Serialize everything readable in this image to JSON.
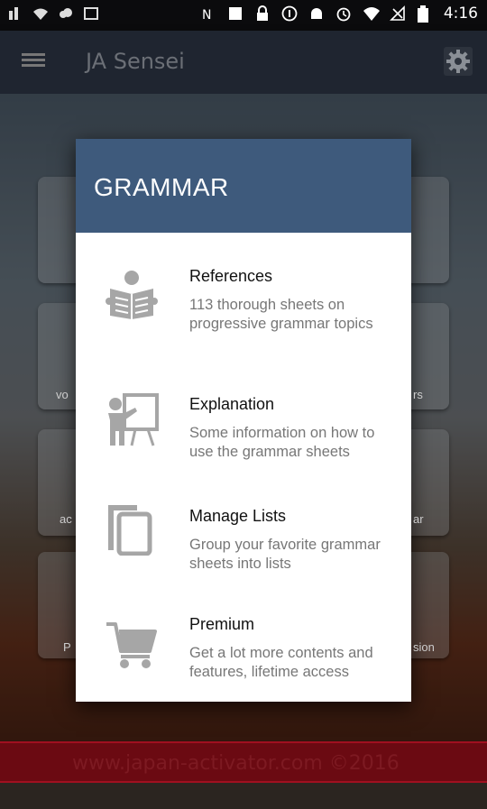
{
  "status_bar": {
    "time": "4:16",
    "left_icons": [
      "notification-icon",
      "wifi-icon",
      "cloud-icon",
      "image-icon"
    ],
    "right_icons": [
      "nfc-icon",
      "stop-icon",
      "lock-icon",
      "info-icon",
      "android-icon",
      "alarm-icon",
      "wifi-signal-icon",
      "no-signal-icon",
      "battery-icon"
    ]
  },
  "app_bar": {
    "title": "JA Sensei"
  },
  "background_tiles": {
    "left_labels": [
      "vo",
      "ac",
      "P"
    ],
    "right_labels": [
      "rs",
      "ar",
      "sion"
    ]
  },
  "modal": {
    "title": "GRAMMAR",
    "items": [
      {
        "label": "References",
        "description": "113 thorough sheets on progressive grammar topics",
        "icon": "reading-book-icon"
      },
      {
        "label": "Explanation",
        "description": "Some information on how to use the grammar sheets",
        "icon": "teacher-board-icon"
      },
      {
        "label": "Manage Lists",
        "description": "Group your favorite grammar sheets into lists",
        "icon": "list-pages-icon"
      },
      {
        "label": "Premium",
        "description": "Get a lot more contents and features, lifetime access",
        "icon": "shopping-cart-icon"
      }
    ]
  },
  "footer": {
    "text": "www.japan-activator.com ©2016"
  },
  "colors": {
    "modal_header": "#3e5a7c",
    "footer": "#6b0a12",
    "icon_gray": "#a6a6a6"
  }
}
